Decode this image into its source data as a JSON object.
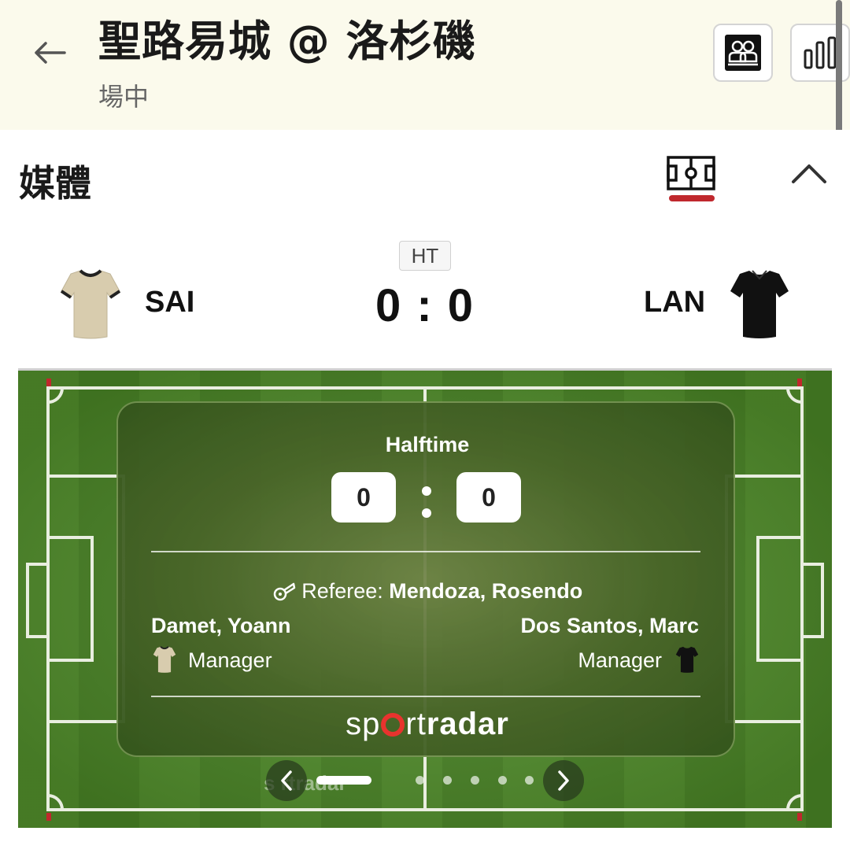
{
  "header": {
    "title": "聖路易城 @ 洛杉磯",
    "status": "場中",
    "icons": {
      "back": "back-arrow-icon",
      "lineups": "lineups-icon",
      "stats": "bar-chart-icon"
    }
  },
  "media": {
    "title": "媒體",
    "icons": {
      "pitch_tab": "pitch-icon",
      "collapse": "chevron-up-icon"
    },
    "accent_color": "#c0282d"
  },
  "scoreboard": {
    "period": "HT",
    "home": {
      "code": "SAI",
      "jersey_color": "#d8ccae"
    },
    "away": {
      "code": "LAN",
      "jersey_color": "#111111"
    },
    "score": "0 : 0"
  },
  "widget": {
    "status": "Halftime",
    "home_score": "0",
    "away_score": "0",
    "referee_label": "Referee:",
    "referee_name": "Mendoza, Rosendo",
    "home_manager": "Damet, Yoann",
    "away_manager": "Dos Santos, Marc",
    "manager_role": "Manager",
    "brand_prefix": "sp",
    "brand_mid": "rt",
    "brand_bold": "radar",
    "ghost_text": "s    rtradar"
  },
  "carousel": {
    "active_index": 0,
    "dot_count": 5,
    "icons": {
      "prev": "chevron-left-icon",
      "next": "chevron-right-icon"
    }
  }
}
